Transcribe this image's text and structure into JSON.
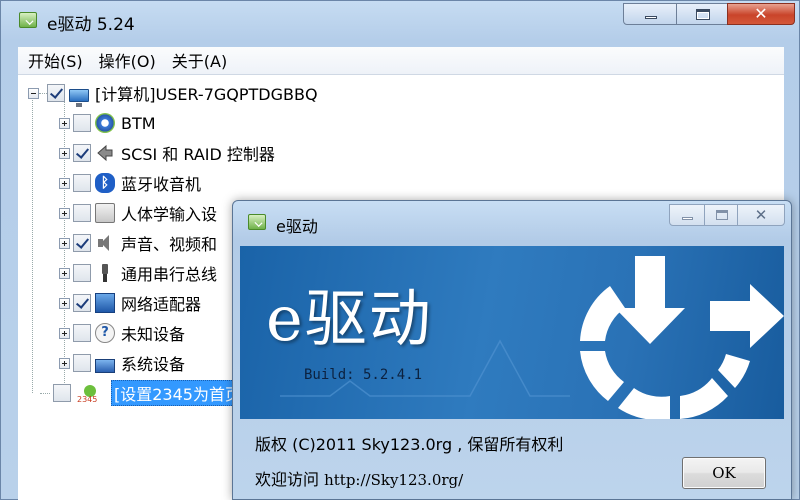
{
  "window": {
    "title": "e驱动 5.24",
    "close_glyph": "✕"
  },
  "menu": {
    "items": [
      "开始(S)",
      "操作(O)",
      "关于(A)"
    ]
  },
  "tree": {
    "root": {
      "label": "[计算机]USER-7GQPTDGBBQ",
      "checked": true,
      "icon": "computer-icon"
    },
    "nodes": [
      {
        "label": "BTM",
        "checked": false,
        "icon": "gear-device-icon"
      },
      {
        "label": "SCSI 和 RAID 控制器",
        "checked": true,
        "icon": "scsi-icon"
      },
      {
        "label": "蓝牙收音机",
        "checked": false,
        "icon": "bluetooth-icon"
      },
      {
        "label": "人体学输入设",
        "checked": false,
        "icon": "hid-icon"
      },
      {
        "label": "声音、视频和",
        "checked": true,
        "icon": "speaker-icon"
      },
      {
        "label": "通用串行总线",
        "checked": false,
        "icon": "usb-icon"
      },
      {
        "label": "网络适配器",
        "checked": true,
        "icon": "network-icon"
      },
      {
        "label": "未知设备",
        "checked": false,
        "icon": "unknown-device-icon"
      },
      {
        "label": "系统设备",
        "checked": false,
        "icon": "system-device-icon"
      }
    ],
    "extra": {
      "label": "[设置2345为首页",
      "checked": false,
      "icon": "2345-icon",
      "selected": true
    }
  },
  "dialog": {
    "title": "e驱动",
    "close_glyph": "✕",
    "banner_title": "e驱动",
    "build": "Build: 5.2.4.1",
    "copyright": "版权 (C)2011 Sky123.0rg , 保留所有权利",
    "welcome_label": "欢迎访问",
    "url": "http://Sky123.0rg/",
    "ok_label": "OK"
  },
  "colors": {
    "banner_blue": "#2a72b6",
    "selection": "#3399ff",
    "close_red": "#c9442a"
  }
}
